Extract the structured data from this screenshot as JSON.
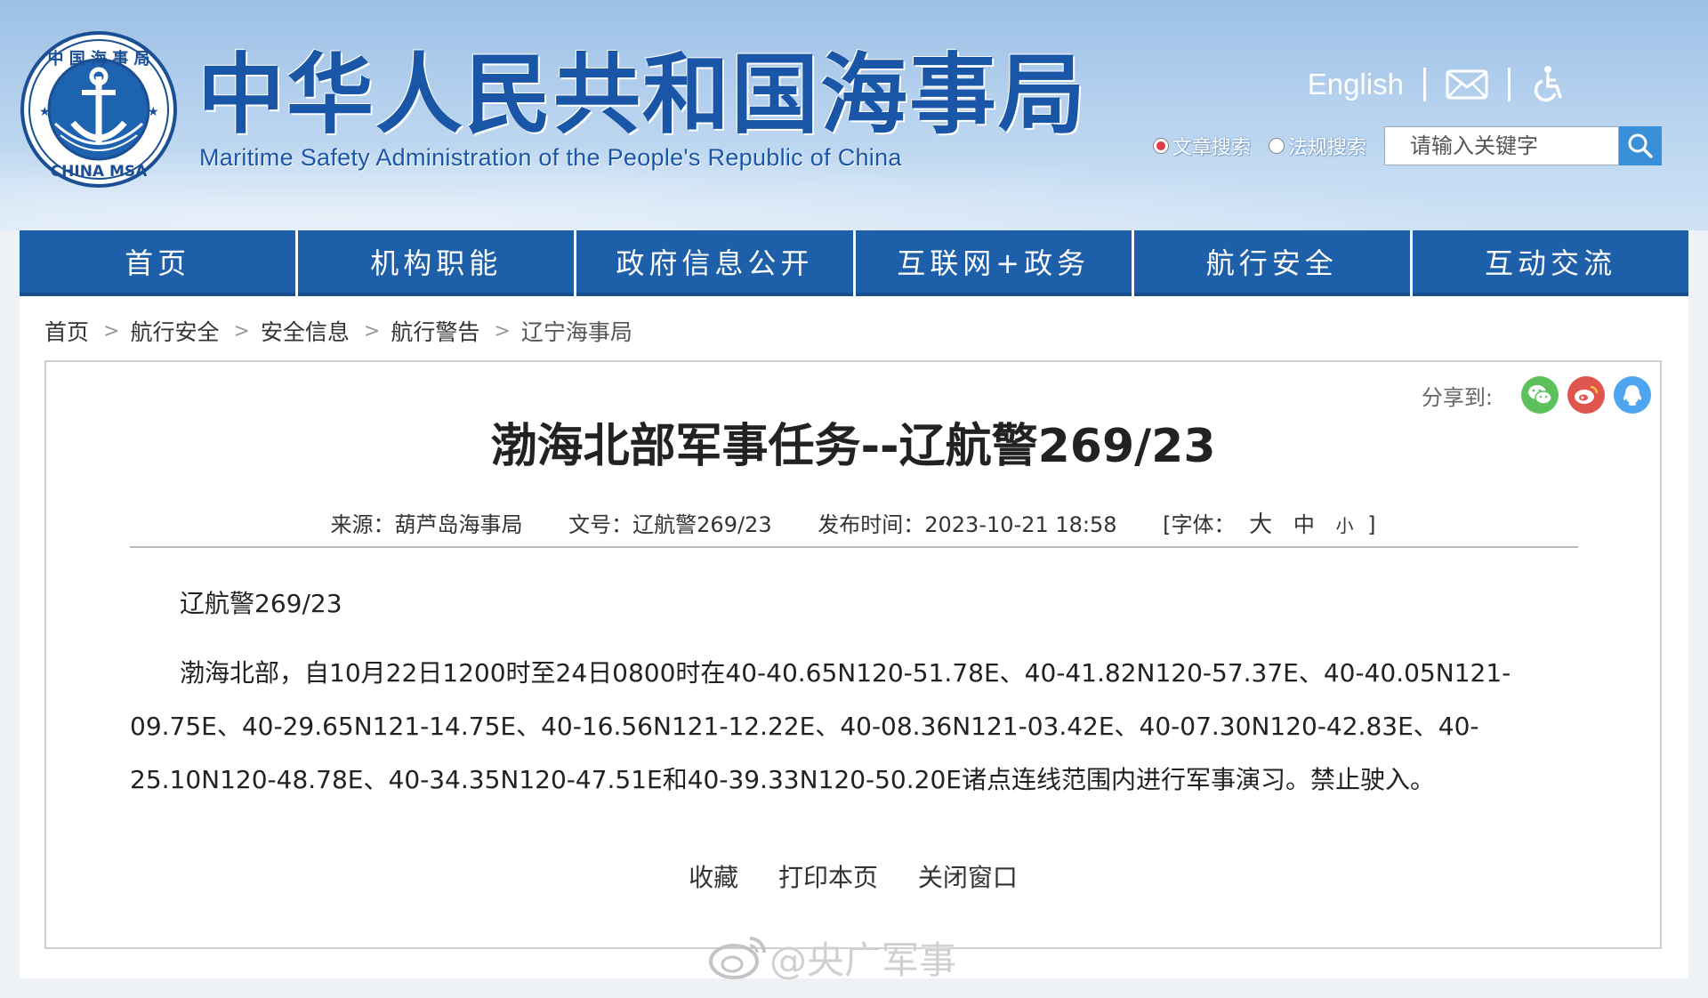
{
  "header": {
    "site_title": "中华人民共和国海事局",
    "site_subtitle": "Maritime Safety Administration of the People's Republic of China",
    "logo_top_text": "中 国 海 事 局",
    "logo_bottom_text": "CHINA MSA",
    "language_link": "English",
    "mail_icon": "mail-icon",
    "accessibility_icon": "wheelchair-icon"
  },
  "search": {
    "option_article": "文章搜索",
    "option_regulation": "法规搜索",
    "selected": "文章搜索",
    "placeholder": "请输入关键字",
    "value": "",
    "icon": "search-icon"
  },
  "nav": {
    "items": [
      "首页",
      "机构职能",
      "政府信息公开",
      "互联网+政务",
      "航行安全",
      "互动交流"
    ]
  },
  "breadcrumb": {
    "items": [
      "首页",
      "航行安全",
      "安全信息",
      "航行警告"
    ],
    "current": "辽宁海事局",
    "separator": ">"
  },
  "article": {
    "share_label": "分享到:",
    "share_icons": [
      "wechat-icon",
      "weibo-icon",
      "qq-icon"
    ],
    "title": "渤海北部军事任务--辽航警269/23",
    "meta": {
      "source": "来源：葫芦岛海事局",
      "doc_no": "文号：辽航警269/23",
      "published": "发布时间：2023-10-21 18:58",
      "font_label": "[字体：",
      "font_large": "大",
      "font_medium": "中",
      "font_small": "小",
      "font_end": "]"
    },
    "ref": "辽航警269/23",
    "body": "渤海北部，自10月22日1200时至24日0800时在40-40.65N120-51.78E、40-41.82N120-57.37E、40-40.05N121-09.75E、40-29.65N121-14.75E、40-16.56N121-12.22E、40-08.36N121-03.42E、40-07.30N120-42.83E、40-25.10N120-48.78E、40-34.35N120-47.51E和40-39.33N120-50.20E诸点连线范围内进行军事演习。禁止驶入。",
    "actions": [
      "收藏",
      "打印本页",
      "关闭窗口"
    ]
  },
  "watermark": "@央广军事",
  "colors": {
    "brand_blue": "#1d5fa9",
    "title_blue": "#1a56a8",
    "search_button": "#3a8fd9",
    "radio_checked": "#e23a4a"
  }
}
